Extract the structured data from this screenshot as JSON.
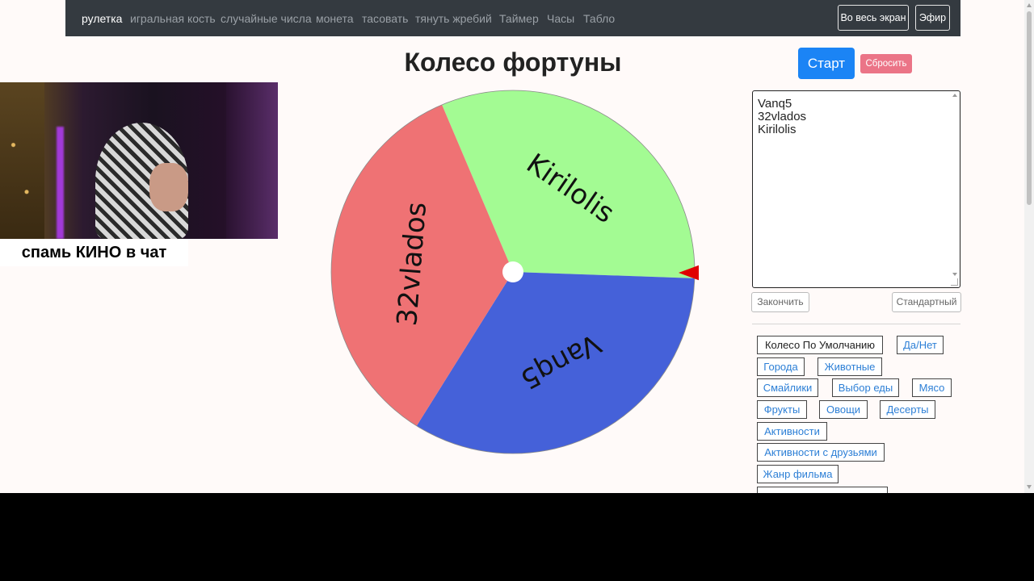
{
  "nav": {
    "links": [
      {
        "label": "рулетка",
        "active": true
      },
      {
        "label": "игральная кость"
      },
      {
        "label": "случайные числа"
      },
      {
        "label": "монета"
      },
      {
        "label": "тасовать"
      },
      {
        "label": "тянуть жребий"
      },
      {
        "label": "Таймер"
      },
      {
        "label": "Часы"
      },
      {
        "label": "Табло"
      }
    ],
    "fullscreen_label": "Во весь экран",
    "broadcast_label": "Эфир"
  },
  "page": {
    "title": "Колесо фортуны",
    "start_label": "Старт",
    "reset_label": "Сбросить",
    "entries_text": "Vanq5\n32vlados\nKirilolis",
    "finish_label": "Закончить",
    "standard_label": "Стандартный"
  },
  "wheel": {
    "segments": [
      {
        "label": "Kirilolis",
        "color": "#a3fb93",
        "start_deg": -113,
        "end_deg": 2
      },
      {
        "label": "Vanq5",
        "color": "#4561d9",
        "start_deg": 2,
        "end_deg": 122
      },
      {
        "label": "32vlados",
        "color": "#ef7274",
        "start_deg": 122,
        "end_deg": 247
      }
    ],
    "pointer_color": "#e00000",
    "hub_color": "#ffffff"
  },
  "presets": [
    {
      "label": "Колесо По Умолчанию",
      "active": true
    },
    {
      "label": "Да/Нет"
    },
    {
      "label": "Города"
    },
    {
      "label": "Животные"
    },
    {
      "label": "Смайлики"
    },
    {
      "label": "Выбор еды"
    },
    {
      "label": "Мясо"
    },
    {
      "label": "Фрукты"
    },
    {
      "label": "Овощи"
    },
    {
      "label": "Десерты"
    },
    {
      "label": "Активности"
    },
    {
      "label": "Активности с друзьями"
    },
    {
      "label": "Жанр фильма"
    }
  ],
  "overlay": {
    "caption": "спамь КИНО в чат"
  }
}
